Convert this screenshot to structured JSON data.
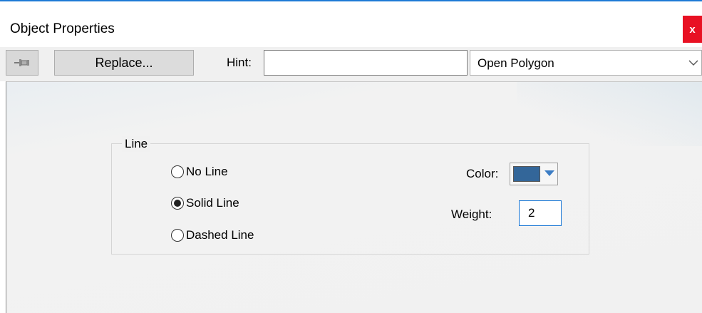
{
  "window": {
    "title": "Object Properties",
    "close_label": "x"
  },
  "toolbar": {
    "pin_icon": "pushpin-icon",
    "replace_label": "Replace...",
    "hint_label": "Hint:",
    "hint_value": "",
    "type_value": "Open Polygon",
    "type_chevron_icon": "chevron-down-icon"
  },
  "line_group": {
    "legend": "Line",
    "options": [
      {
        "label": "No Line",
        "checked": false
      },
      {
        "label": "Solid Line",
        "checked": true
      },
      {
        "label": "Dashed Line",
        "checked": false
      }
    ],
    "color_label": "Color:",
    "color_value": "#336699",
    "weight_label": "Weight:",
    "weight_value": "2"
  },
  "colors": {
    "accent": "#1e7ad6",
    "close_button": "#e81123"
  }
}
